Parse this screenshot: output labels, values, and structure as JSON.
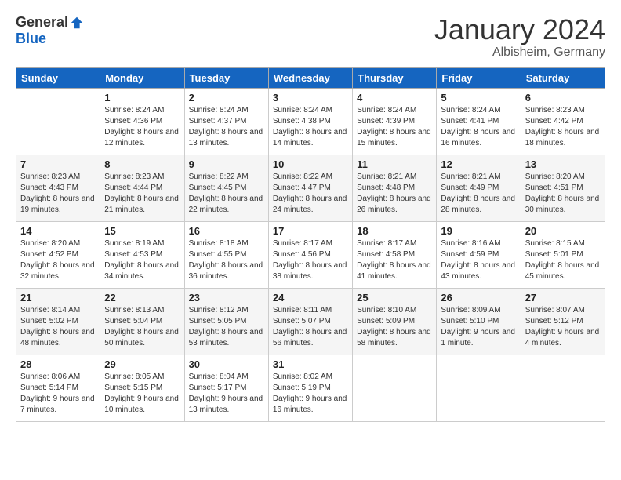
{
  "header": {
    "logo_general": "General",
    "logo_blue": "Blue",
    "month_title": "January 2024",
    "location": "Albisheim, Germany"
  },
  "days": [
    "Sunday",
    "Monday",
    "Tuesday",
    "Wednesday",
    "Thursday",
    "Friday",
    "Saturday"
  ],
  "weeks": [
    [
      {
        "date": "",
        "sunrise": "",
        "sunset": "",
        "daylight": ""
      },
      {
        "date": "1",
        "sunrise": "Sunrise: 8:24 AM",
        "sunset": "Sunset: 4:36 PM",
        "daylight": "Daylight: 8 hours and 12 minutes."
      },
      {
        "date": "2",
        "sunrise": "Sunrise: 8:24 AM",
        "sunset": "Sunset: 4:37 PM",
        "daylight": "Daylight: 8 hours and 13 minutes."
      },
      {
        "date": "3",
        "sunrise": "Sunrise: 8:24 AM",
        "sunset": "Sunset: 4:38 PM",
        "daylight": "Daylight: 8 hours and 14 minutes."
      },
      {
        "date": "4",
        "sunrise": "Sunrise: 8:24 AM",
        "sunset": "Sunset: 4:39 PM",
        "daylight": "Daylight: 8 hours and 15 minutes."
      },
      {
        "date": "5",
        "sunrise": "Sunrise: 8:24 AM",
        "sunset": "Sunset: 4:41 PM",
        "daylight": "Daylight: 8 hours and 16 minutes."
      },
      {
        "date": "6",
        "sunrise": "Sunrise: 8:23 AM",
        "sunset": "Sunset: 4:42 PM",
        "daylight": "Daylight: 8 hours and 18 minutes."
      }
    ],
    [
      {
        "date": "7",
        "sunrise": "Sunrise: 8:23 AM",
        "sunset": "Sunset: 4:43 PM",
        "daylight": "Daylight: 8 hours and 19 minutes."
      },
      {
        "date": "8",
        "sunrise": "Sunrise: 8:23 AM",
        "sunset": "Sunset: 4:44 PM",
        "daylight": "Daylight: 8 hours and 21 minutes."
      },
      {
        "date": "9",
        "sunrise": "Sunrise: 8:22 AM",
        "sunset": "Sunset: 4:45 PM",
        "daylight": "Daylight: 8 hours and 22 minutes."
      },
      {
        "date": "10",
        "sunrise": "Sunrise: 8:22 AM",
        "sunset": "Sunset: 4:47 PM",
        "daylight": "Daylight: 8 hours and 24 minutes."
      },
      {
        "date": "11",
        "sunrise": "Sunrise: 8:21 AM",
        "sunset": "Sunset: 4:48 PM",
        "daylight": "Daylight: 8 hours and 26 minutes."
      },
      {
        "date": "12",
        "sunrise": "Sunrise: 8:21 AM",
        "sunset": "Sunset: 4:49 PM",
        "daylight": "Daylight: 8 hours and 28 minutes."
      },
      {
        "date": "13",
        "sunrise": "Sunrise: 8:20 AM",
        "sunset": "Sunset: 4:51 PM",
        "daylight": "Daylight: 8 hours and 30 minutes."
      }
    ],
    [
      {
        "date": "14",
        "sunrise": "Sunrise: 8:20 AM",
        "sunset": "Sunset: 4:52 PM",
        "daylight": "Daylight: 8 hours and 32 minutes."
      },
      {
        "date": "15",
        "sunrise": "Sunrise: 8:19 AM",
        "sunset": "Sunset: 4:53 PM",
        "daylight": "Daylight: 8 hours and 34 minutes."
      },
      {
        "date": "16",
        "sunrise": "Sunrise: 8:18 AM",
        "sunset": "Sunset: 4:55 PM",
        "daylight": "Daylight: 8 hours and 36 minutes."
      },
      {
        "date": "17",
        "sunrise": "Sunrise: 8:17 AM",
        "sunset": "Sunset: 4:56 PM",
        "daylight": "Daylight: 8 hours and 38 minutes."
      },
      {
        "date": "18",
        "sunrise": "Sunrise: 8:17 AM",
        "sunset": "Sunset: 4:58 PM",
        "daylight": "Daylight: 8 hours and 41 minutes."
      },
      {
        "date": "19",
        "sunrise": "Sunrise: 8:16 AM",
        "sunset": "Sunset: 4:59 PM",
        "daylight": "Daylight: 8 hours and 43 minutes."
      },
      {
        "date": "20",
        "sunrise": "Sunrise: 8:15 AM",
        "sunset": "Sunset: 5:01 PM",
        "daylight": "Daylight: 8 hours and 45 minutes."
      }
    ],
    [
      {
        "date": "21",
        "sunrise": "Sunrise: 8:14 AM",
        "sunset": "Sunset: 5:02 PM",
        "daylight": "Daylight: 8 hours and 48 minutes."
      },
      {
        "date": "22",
        "sunrise": "Sunrise: 8:13 AM",
        "sunset": "Sunset: 5:04 PM",
        "daylight": "Daylight: 8 hours and 50 minutes."
      },
      {
        "date": "23",
        "sunrise": "Sunrise: 8:12 AM",
        "sunset": "Sunset: 5:05 PM",
        "daylight": "Daylight: 8 hours and 53 minutes."
      },
      {
        "date": "24",
        "sunrise": "Sunrise: 8:11 AM",
        "sunset": "Sunset: 5:07 PM",
        "daylight": "Daylight: 8 hours and 56 minutes."
      },
      {
        "date": "25",
        "sunrise": "Sunrise: 8:10 AM",
        "sunset": "Sunset: 5:09 PM",
        "daylight": "Daylight: 8 hours and 58 minutes."
      },
      {
        "date": "26",
        "sunrise": "Sunrise: 8:09 AM",
        "sunset": "Sunset: 5:10 PM",
        "daylight": "Daylight: 9 hours and 1 minute."
      },
      {
        "date": "27",
        "sunrise": "Sunrise: 8:07 AM",
        "sunset": "Sunset: 5:12 PM",
        "daylight": "Daylight: 9 hours and 4 minutes."
      }
    ],
    [
      {
        "date": "28",
        "sunrise": "Sunrise: 8:06 AM",
        "sunset": "Sunset: 5:14 PM",
        "daylight": "Daylight: 9 hours and 7 minutes."
      },
      {
        "date": "29",
        "sunrise": "Sunrise: 8:05 AM",
        "sunset": "Sunset: 5:15 PM",
        "daylight": "Daylight: 9 hours and 10 minutes."
      },
      {
        "date": "30",
        "sunrise": "Sunrise: 8:04 AM",
        "sunset": "Sunset: 5:17 PM",
        "daylight": "Daylight: 9 hours and 13 minutes."
      },
      {
        "date": "31",
        "sunrise": "Sunrise: 8:02 AM",
        "sunset": "Sunset: 5:19 PM",
        "daylight": "Daylight: 9 hours and 16 minutes."
      },
      {
        "date": "",
        "sunrise": "",
        "sunset": "",
        "daylight": ""
      },
      {
        "date": "",
        "sunrise": "",
        "sunset": "",
        "daylight": ""
      },
      {
        "date": "",
        "sunrise": "",
        "sunset": "",
        "daylight": ""
      }
    ]
  ]
}
